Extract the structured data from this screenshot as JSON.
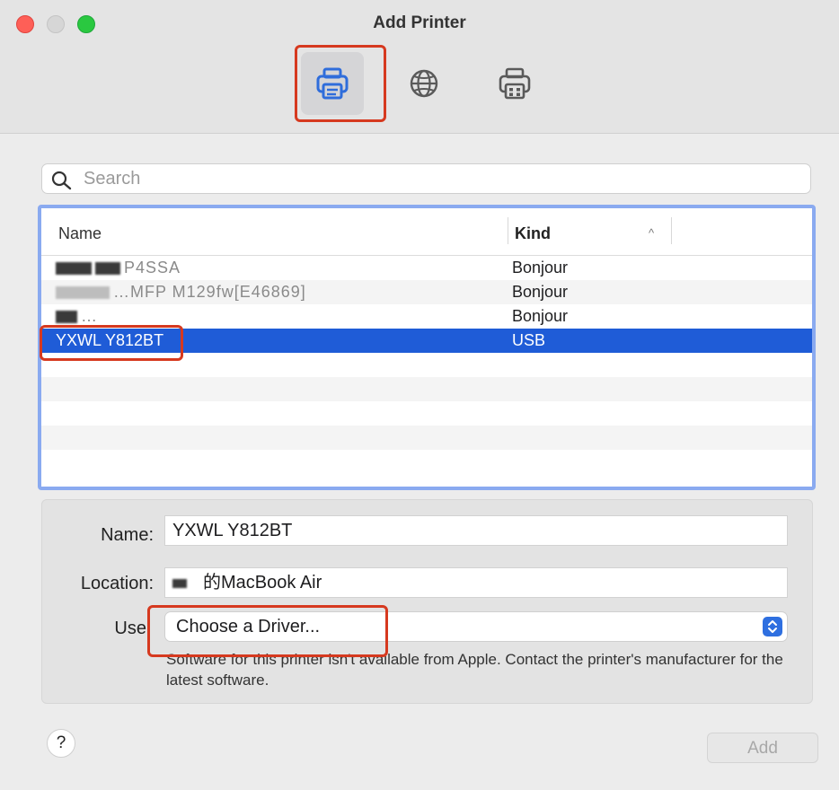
{
  "window": {
    "title": "Add Printer"
  },
  "toolbar": {
    "buttons": [
      "default-printer",
      "ip-printer",
      "windows-printer"
    ]
  },
  "search": {
    "placeholder": "Search",
    "value": ""
  },
  "list": {
    "columns": {
      "name": "Name",
      "kind": "Kind",
      "sort": "ascending"
    },
    "rows": [
      {
        "name": "P4SSA",
        "kind": "Bonjour",
        "redacted": true
      },
      {
        "name": "…MFP M129fw[E46869]",
        "kind": "Bonjour",
        "redacted": true
      },
      {
        "name": "…",
        "kind": "Bonjour",
        "redacted": true
      },
      {
        "name": "YXWL Y812BT",
        "kind": "USB",
        "selected": true
      },
      {
        "name": "",
        "kind": ""
      },
      {
        "name": "",
        "kind": ""
      },
      {
        "name": "",
        "kind": ""
      },
      {
        "name": "",
        "kind": ""
      },
      {
        "name": "",
        "kind": ""
      }
    ]
  },
  "details": {
    "name_label": "Name:",
    "name_value": "YXWL Y812BT",
    "location_label": "Location:",
    "location_value": "的MacBook Air",
    "use_label": "Use",
    "use_value": "Choose a Driver...",
    "note": "Software for this printer isn't available from Apple. Contact the printer's manufacturer for the latest software."
  },
  "footer": {
    "help_label": "?",
    "add_label": "Add"
  },
  "colors": {
    "selection": "#1f5cd7",
    "list_border": "#8aaaf0",
    "annotation": "#d6391f"
  }
}
